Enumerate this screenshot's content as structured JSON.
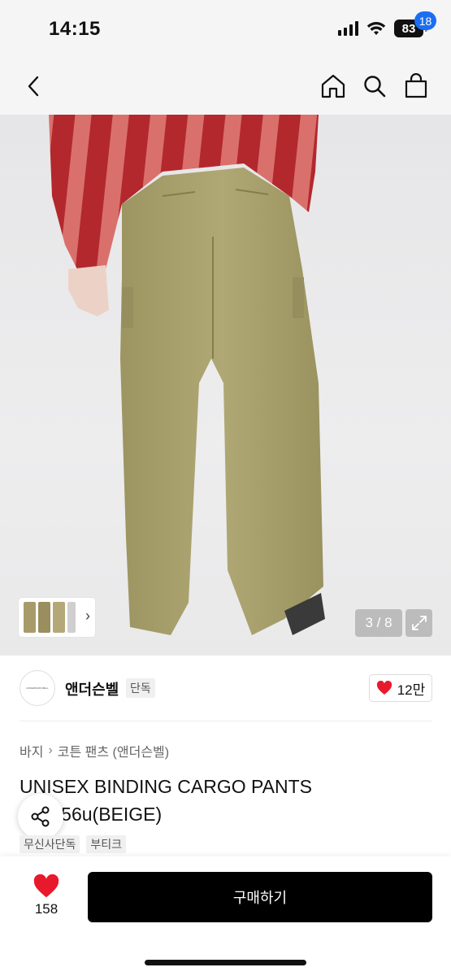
{
  "status_bar": {
    "time": "14:15",
    "battery": "83",
    "icons": [
      "signal-icon",
      "wifi-icon",
      "battery-icon"
    ]
  },
  "nav": {
    "cart_badge": "18",
    "icons": [
      "chevron-left-icon",
      "home-icon",
      "search-icon",
      "shopping-bag-icon"
    ],
    "accent": "#1b6ef3"
  },
  "gallery": {
    "counter": "3 / 8",
    "current": 3,
    "total": 8,
    "image_subject": "product photo of khaki cargo pants worn with a red striped sweater"
  },
  "brand": {
    "logo_text": "ANDERSSON BELL",
    "name": "앤더슨벨",
    "exclusive_tag": "단독",
    "likes": "12만"
  },
  "breadcrumb": {
    "category": "바지",
    "subcategory": "코튼 팬츠 (앤더슨벨)"
  },
  "product": {
    "title": "UNISEX BINDING CARGO PANTS apa856u(BEIGE)",
    "tags": [
      "무신사단독",
      "부티크"
    ]
  },
  "bottom_bar": {
    "wish_count": "158",
    "buy_label": "구매하기",
    "heart_color": "#e8192c"
  }
}
